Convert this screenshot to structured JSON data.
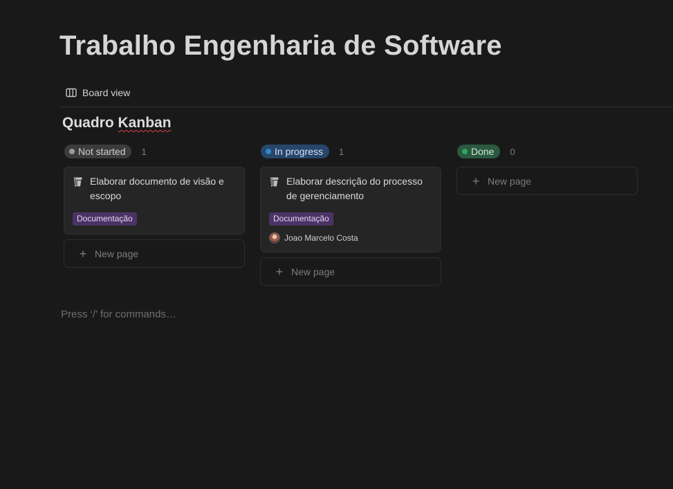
{
  "page": {
    "title": "Trabalho Engenharia de Software"
  },
  "view": {
    "tab_label": "Board view",
    "tab_icon": "board-view-icon"
  },
  "database": {
    "title_part1": "Quadro ",
    "title_part2": "Kanban"
  },
  "colors": {
    "background": "#191919",
    "not_started_pill": "#3b3b3b",
    "not_started_dot": "#9b9b9b",
    "in_progress_pill": "#28456c",
    "in_progress_dot": "#2d89c8",
    "done_pill": "#2b593f",
    "done_dot": "#2ea663",
    "tag_documentacao": "#4b3366"
  },
  "columns": [
    {
      "status": "Not started",
      "count": "1",
      "cards": [
        {
          "title": "Elaborar documento de visão e escopo",
          "tag": "Documentação",
          "icon": "document-icon"
        }
      ],
      "new_page_label": "New page"
    },
    {
      "status": "In progress",
      "count": "1",
      "cards": [
        {
          "title": "Elaborar descrição do processo de gerenciamento",
          "tag": "Documentação",
          "assignee": "Joao Marcelo Costa",
          "icon": "document-icon"
        }
      ],
      "new_page_label": "New page"
    },
    {
      "status": "Done",
      "count": "0",
      "cards": [],
      "new_page_label": "New page"
    }
  ],
  "editor": {
    "placeholder": "Press ‘/’ for commands…"
  }
}
